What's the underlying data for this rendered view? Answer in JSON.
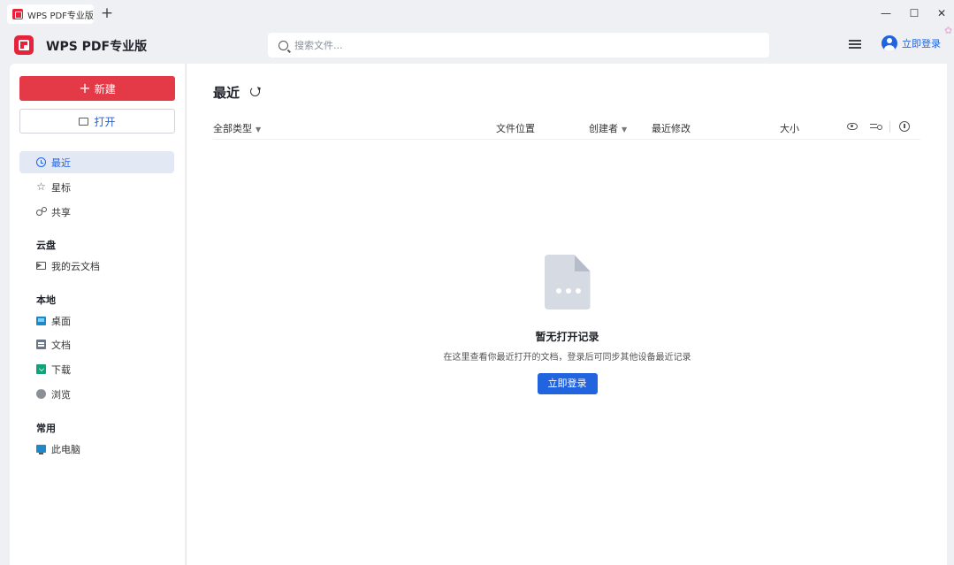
{
  "window": {
    "tab_title": "WPS PDF专业版",
    "new_tab": "+",
    "minimize": "—",
    "maximize": "☐",
    "close": "✕"
  },
  "header": {
    "app_title": "WPS PDF专业版",
    "search_placeholder": "搜索文件...",
    "login_label": "立即登录"
  },
  "sidebar": {
    "new_label": "新建",
    "new_plus": "+",
    "open_label": "打开",
    "nav": [
      {
        "label": "最近",
        "icon": "clock-icon",
        "active": true
      },
      {
        "label": "星标",
        "icon": "star-icon"
      },
      {
        "label": "共享",
        "icon": "share-icon"
      }
    ],
    "cloud_section": "云盘",
    "cloud_items": [
      {
        "label": "我的云文档",
        "icon": "cloud-folder-icon"
      }
    ],
    "local_section": "本地",
    "local_items": [
      {
        "label": "桌面",
        "icon": "desktop-icon"
      },
      {
        "label": "文档",
        "icon": "document-icon"
      },
      {
        "label": "下载",
        "icon": "download-icon"
      },
      {
        "label": "浏览",
        "icon": "browse-icon"
      }
    ],
    "common_section": "常用",
    "common_items": [
      {
        "label": "此电脑",
        "icon": "computer-icon"
      }
    ]
  },
  "main": {
    "title": "最近",
    "columns": {
      "type": "全部类型",
      "location": "文件位置",
      "creator": "创建者",
      "modified": "最近修改",
      "size": "大小"
    },
    "empty": {
      "title": "暂无打开记录",
      "description": "在这里查看你最近打开的文档，登录后可同步其他设备最近记录",
      "button": "立即登录"
    }
  },
  "colors": {
    "brand_red": "#e43a48",
    "accent_blue": "#2264e0",
    "background": "#eef0f4"
  }
}
